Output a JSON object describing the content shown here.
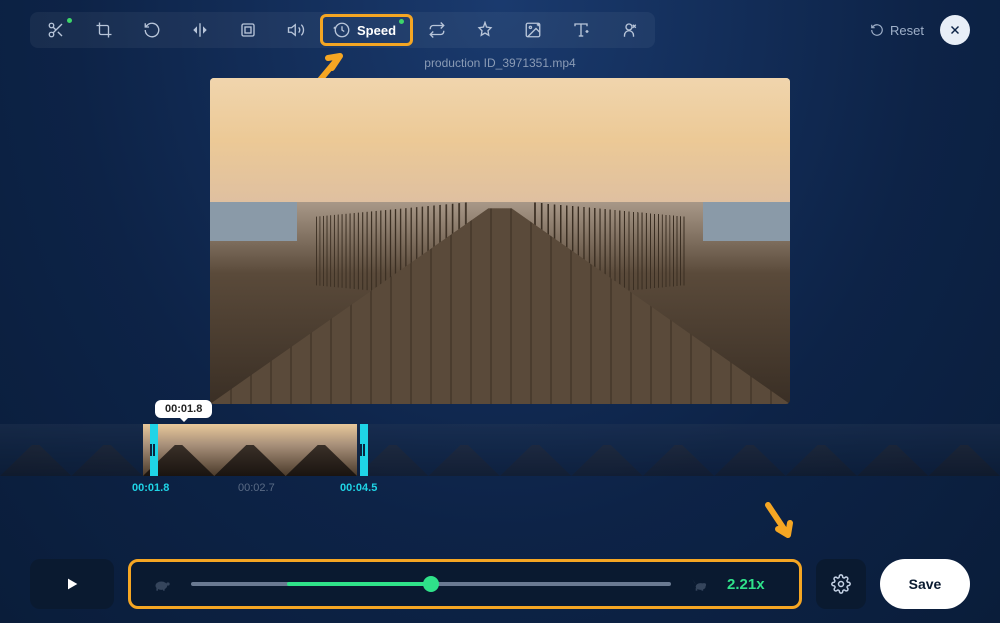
{
  "toolbar": {
    "speed_label": "Speed",
    "reset_label": "Reset"
  },
  "filename": "production ID_3971351.mp4",
  "timeline": {
    "tooltip_time": "00:01.8",
    "labels": [
      {
        "time": "00:01.8",
        "active": true,
        "pos": 132
      },
      {
        "time": "00:02.7",
        "active": false,
        "pos": 238
      },
      {
        "time": "00:04.5",
        "active": true,
        "pos": 340
      }
    ]
  },
  "speed": {
    "value_display": "2.21x",
    "slider_percent": 50,
    "fill_start_percent": 20,
    "fill_width_percent": 30
  },
  "save_label": "Save"
}
